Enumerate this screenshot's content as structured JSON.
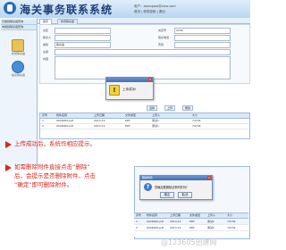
{
  "header": {
    "title": "海关事务联系系统",
    "user_info": "用户：asianpost@sina.com",
    "links": "首页 | 修改密码 | 退出"
  },
  "sidebar": {
    "menu": [
      "已报批联系函查询",
      "未报批联系函查询"
    ],
    "icons": [
      {
        "label": "新增联系函",
        "icon": "document-add-icon"
      },
      {
        "label": "提交联系函",
        "icon": "globe-icon"
      }
    ]
  },
  "tabs": [
    "首页",
    "新增联系函"
  ],
  "form": {
    "rows": [
      {
        "label": "关区",
        "value": "",
        "label2": "关区号",
        "value2": "2244"
      },
      {
        "label": "联系人",
        "value": "",
        "label2": "联系电话",
        "value2": ""
      },
      {
        "label": "类别",
        "value": "联系函",
        "label2": "传真",
        "value2": ""
      },
      {
        "label": "主题",
        "value": "",
        "label2": "",
        "value2": ""
      },
      {
        "label": "内容",
        "value": "",
        "label2": "",
        "value2": ""
      }
    ]
  },
  "dialog1": {
    "title": "提示",
    "message": "上传成功!"
  },
  "attachments": {
    "toolbar": [
      "选择",
      "上传",
      "删除"
    ],
    "headers": [
      "序号",
      "附件名称",
      "上传日期",
      "文件类型",
      "上传人",
      "大小"
    ],
    "rows": [
      [
        "1",
        "0026000.pdf",
        "2013-12",
        "PDF",
        "测试1",
        "74734"
      ],
      [
        "2",
        "0026000.pdf",
        "2013-12",
        "PDF",
        "测试1",
        "74734"
      ]
    ]
  },
  "notes": [
    "上传成功后，系统作相应提示。",
    "如需删除附件直接点击“删除”",
    "后，会提示是否删除附件，点击",
    "“确定”即可删除附件。"
  ],
  "dialog2": {
    "title": "删除附件",
    "message": "您确定要删除这条附件吗?",
    "ok_label": "确定",
    "cancel_label": "取消"
  },
  "grid2": {
    "headers": [
      "序号",
      "附件名称",
      "上传日期",
      "文件类型",
      "上传人",
      "大小"
    ],
    "rows": [
      [
        "1",
        "0026000.pdf",
        "2013-12",
        "PDF",
        "测试1",
        "74734"
      ],
      [
        "2",
        "0026000.pdf",
        "2013-12",
        "PDF",
        "测试1",
        "74734"
      ]
    ]
  },
  "watermark": "@123605创建网",
  "colors": {
    "accent": "#2b6cb4",
    "note_red": "#d9251d",
    "header_bg": "#cfe2f6"
  }
}
